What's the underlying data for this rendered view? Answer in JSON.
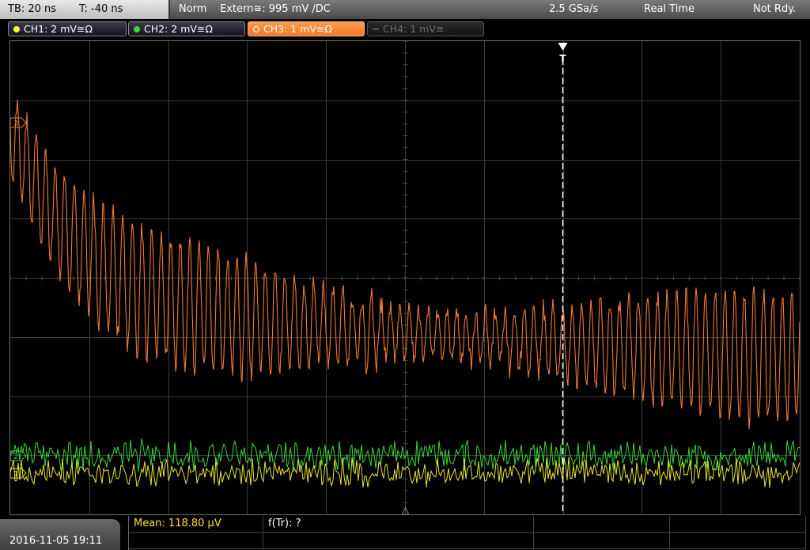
{
  "topbar": {
    "timebase": "TB: 20 ns",
    "trigger_offset": "T: -40 ns",
    "mode": "Norm",
    "trigger_source": "Extern≅: 995 mV ∕DC",
    "sample_rate": "2.5 GSa/s",
    "acquisition": "Real Time",
    "status": "Not Rdy."
  },
  "channels": [
    {
      "label": "CH1: 2 mV≅Ω",
      "color": "#ffff33",
      "state": "on"
    },
    {
      "label": "CH2: 2 mV≅Ω",
      "color": "#33dd33",
      "state": "on"
    },
    {
      "label": "CH3: 1 mV≅Ω",
      "color": "#ff8c3c",
      "state": "selected"
    },
    {
      "label": "CH4: 1 mV≅",
      "color": "#6e6e6e",
      "state": "off"
    }
  ],
  "screen": {
    "trigger_marker": "T",
    "ch3_marker": "3",
    "ch2_marker": "2",
    "ch1_marker": "1",
    "grid_color": "#3c3c3c",
    "trace_colors": {
      "ch1": "#e8e62e",
      "ch2": "#39d83a",
      "ch3": "#f07b35"
    }
  },
  "footer": {
    "datetime": "2016-11-05 19:11",
    "measurement_mean": "Mean: 118.80 µV",
    "measurement_freq": "f(Tr): ?"
  }
}
